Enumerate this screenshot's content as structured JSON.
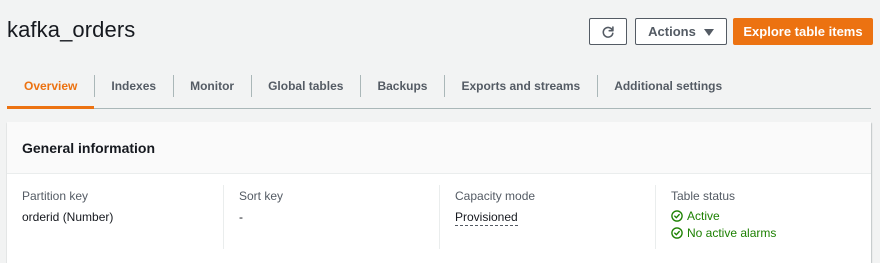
{
  "page": {
    "title": "kafka_orders"
  },
  "toolbar": {
    "actions_label": "Actions",
    "explore_label": "Explore table items"
  },
  "tabs": [
    {
      "label": "Overview"
    },
    {
      "label": "Indexes"
    },
    {
      "label": "Monitor"
    },
    {
      "label": "Global tables"
    },
    {
      "label": "Backups"
    },
    {
      "label": "Exports and streams"
    },
    {
      "label": "Additional settings"
    }
  ],
  "general_info": {
    "title": "General information",
    "partition_key": {
      "label": "Partition key",
      "value": "orderid (Number)"
    },
    "sort_key": {
      "label": "Sort key",
      "value": "-"
    },
    "capacity_mode": {
      "label": "Capacity mode",
      "value": "Provisioned"
    },
    "table_status": {
      "label": "Table status",
      "status": "Active",
      "alarms": "No active alarms"
    }
  },
  "colors": {
    "accent": "#ec7211",
    "success": "#1d8102",
    "text": "#16191f",
    "secondary_text": "#545b64"
  },
  "icons": [
    "refresh-icon",
    "caret-down-icon",
    "check-circle-icon"
  ]
}
